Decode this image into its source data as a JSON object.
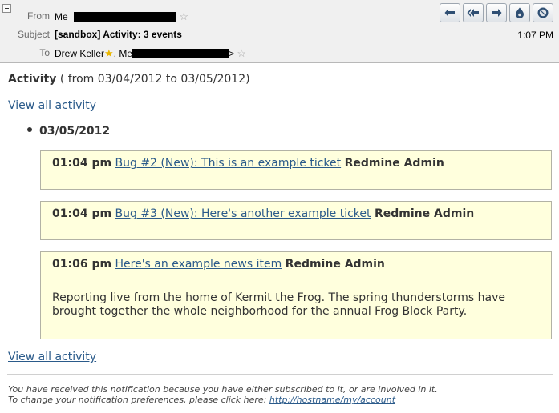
{
  "header": {
    "from_label": "From",
    "from_value": "Me",
    "subject_label": "Subject",
    "subject_value": "[sandbox] Activity: 3 events",
    "to_label": "To",
    "to_first": "Drew Keller",
    "to_second": "Me",
    "to_suffix": ">",
    "time": "1:07 PM",
    "actions": [
      "reply-icon",
      "reply-all-icon",
      "forward-icon",
      "junk-icon",
      "delete-icon"
    ]
  },
  "body": {
    "title_bold": "Activity",
    "title_range": " ( from 03/04/2012 to 03/05/2012)",
    "view_all_top": "View all activity",
    "date": "03/05/2012",
    "events": [
      {
        "time": "01:04 pm",
        "link": "Bug #2 (New): This is an example ticket",
        "author": "Redmine Admin"
      },
      {
        "time": "01:04 pm",
        "link": "Bug #3 (New): Here's another example ticket",
        "author": "Redmine Admin"
      },
      {
        "time": "01:06 pm",
        "link": "Here's an example news item",
        "author": "Redmine Admin",
        "desc_line1": "Reporting live from the home of Kermit the Frog. The spring thunderstorms have",
        "desc_line2": "brought together the whole neighborhood for the annual Frog Block Party."
      }
    ],
    "view_all_bottom": "View all activity"
  },
  "footer": {
    "line1": "You have received this notification because you have either subscribed to it, or are involved in it.",
    "line2_prefix": "To change your notification preferences, please click here: ",
    "line2_link": "http://hostname/my/account"
  },
  "colors": {
    "link": "#2a5a8a",
    "event_bg": "#ffffdd",
    "header_bg": "#f0f0f0"
  }
}
